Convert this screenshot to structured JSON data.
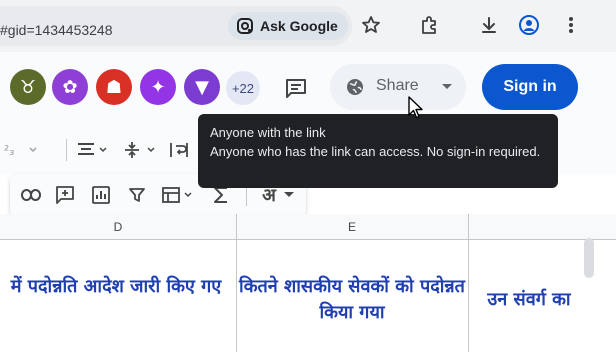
{
  "browser": {
    "url": "#gid=1434453248",
    "ask_google_label": "Ask Google"
  },
  "header": {
    "avatars": [
      {
        "name": "avatar-1",
        "color": "#5b6b2a",
        "glyph": "♉"
      },
      {
        "name": "avatar-2",
        "color": "#8e3fd6",
        "glyph": "✿"
      },
      {
        "name": "avatar-3",
        "color": "#d93025",
        "glyph": "☗"
      },
      {
        "name": "avatar-4",
        "color": "#9334e6",
        "glyph": "✦"
      },
      {
        "name": "avatar-5",
        "color": "#7c3bd1",
        "glyph": "▼"
      }
    ],
    "more_count": "+22",
    "share_label": "Share",
    "signin_label": "Sign in"
  },
  "tooltip": {
    "title": "Anyone with the link",
    "description": "Anyone who has the link can access. No sign-in required."
  },
  "toolbar": {
    "language_glyph": "अ"
  },
  "grid": {
    "columns": [
      "D",
      "E"
    ],
    "cells": {
      "d": "में पदोन्नति आदेश जारी किए गए",
      "e": "कितने शासकीय सेवकों को पदोन्नत किया गया",
      "f": "उन संवर्ग का"
    }
  },
  "colors": {
    "signin_bg": "#0b57d0",
    "tooltip_bg": "#202124",
    "cell_text": "#1f3fb0"
  }
}
